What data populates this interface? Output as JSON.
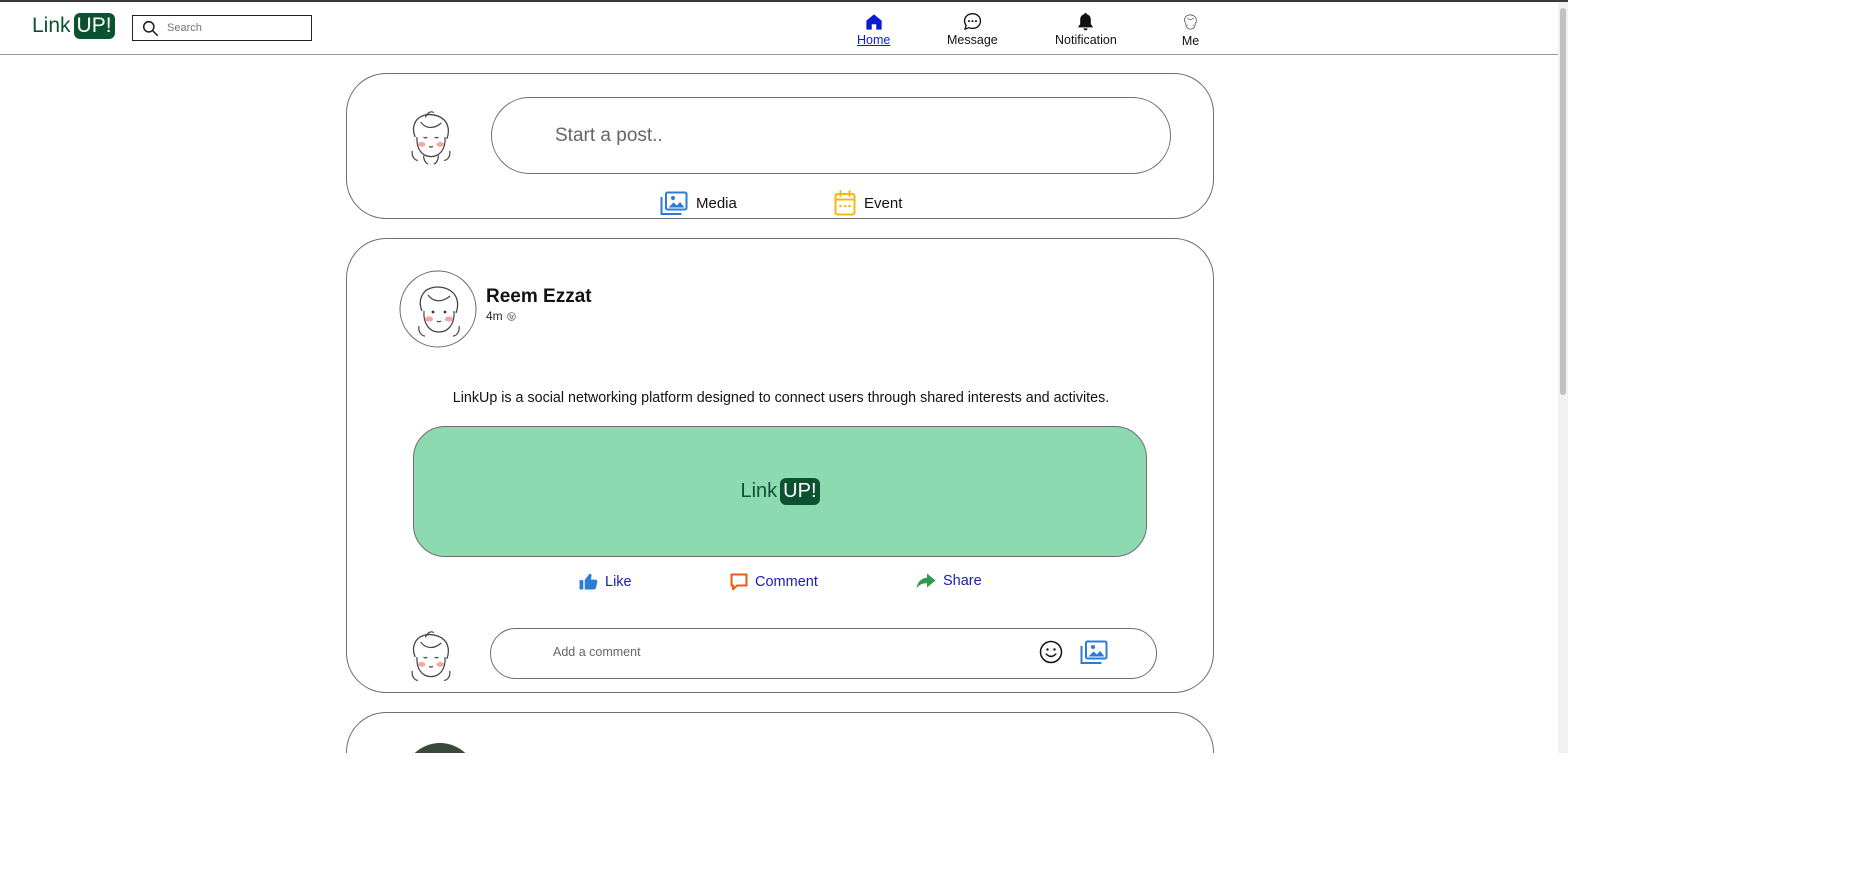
{
  "header": {
    "logo_text": "Link",
    "logo_badge": "UP!",
    "search_placeholder": "Search",
    "nav": [
      {
        "label": "Home",
        "icon": "home-icon",
        "active": true
      },
      {
        "label": "Message",
        "icon": "message-icon",
        "active": false
      },
      {
        "label": "Notification",
        "icon": "bell-icon",
        "active": false
      },
      {
        "label": "Me",
        "icon": "avatar",
        "active": false
      }
    ]
  },
  "composer": {
    "placeholder": "Start a post..",
    "actions": [
      {
        "label": "Media",
        "icon": "media-icon"
      },
      {
        "label": "Event",
        "icon": "calendar-icon"
      }
    ]
  },
  "post": {
    "author": "Reem Ezzat",
    "time": "4m",
    "visibility_icon": "globe-icon",
    "text": "LinkUp is a social networking platform designed to connect users through shared interests and activites.",
    "image_logo_text": "Link",
    "image_logo_badge": "UP!",
    "reactions": [
      {
        "label": "Like",
        "icon": "thumbs-up-icon"
      },
      {
        "label": "Comment",
        "icon": "comment-icon"
      },
      {
        "label": "Share",
        "icon": "share-icon"
      }
    ],
    "comment_placeholder": "Add a comment"
  },
  "colors": {
    "brand": "#0c5230",
    "image_bg": "#8ddab1",
    "link": "#1a1ab5",
    "media": "#2b7bd8",
    "event": "#f2b81a",
    "comment": "#e85a12",
    "share": "#2e9a4c"
  }
}
